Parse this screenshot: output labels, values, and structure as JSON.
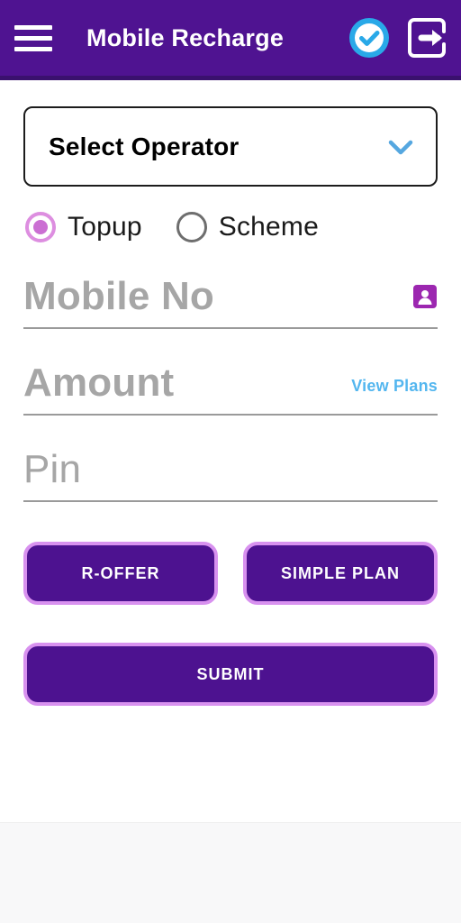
{
  "header": {
    "title": "Mobile Recharge",
    "menu_icon": "hamburger-icon",
    "verified_icon": "verified-check-icon",
    "logout_icon": "logout-icon"
  },
  "form": {
    "operator": {
      "label": "Select Operator",
      "chevron_icon": "chevron-down-icon"
    },
    "recharge_type": {
      "options": [
        {
          "label": "Topup",
          "selected": true
        },
        {
          "label": "Scheme",
          "selected": false
        }
      ]
    },
    "mobile": {
      "placeholder": "Mobile No",
      "value": "",
      "contact_icon": "contact-book-icon"
    },
    "amount": {
      "placeholder": "Amount",
      "value": "",
      "view_plans_label": "View Plans"
    },
    "pin": {
      "placeholder": "Pin",
      "value": ""
    },
    "buttons": {
      "r_offer": "R-OFFER",
      "simple_plan": "SIMPLE PLAN",
      "submit": "SUBMIT"
    }
  },
  "colors": {
    "appbar": "#4f1391",
    "appbar_shadow": "#3a116e",
    "button_fill": "#4d1290",
    "button_border": "#d891ef",
    "radio_on": "#cb6fd3",
    "link": "#53b6ef",
    "chevron": "#55a7e0",
    "placeholder": "#a6a6a6"
  }
}
